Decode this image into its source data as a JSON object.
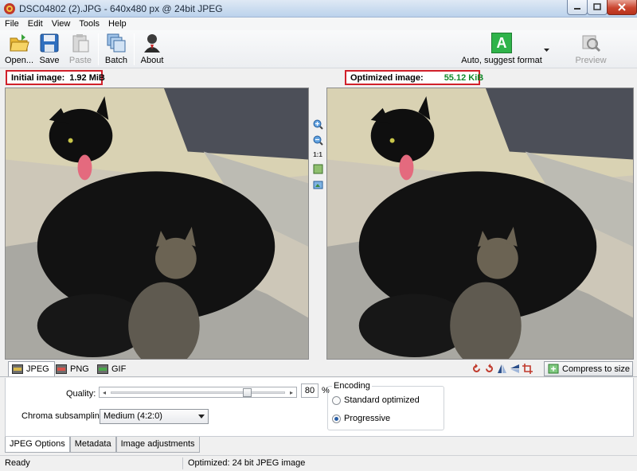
{
  "window": {
    "title": "DSC04802 (2).JPG - 640x480 px @ 24bit JPEG"
  },
  "menu": [
    "File",
    "Edit",
    "View",
    "Tools",
    "Help"
  ],
  "toolbar": {
    "open": "Open...",
    "save": "Save",
    "paste": "Paste",
    "batch": "Batch",
    "about": "About",
    "auto_format": "Auto, suggest format",
    "auto_format_letter": "A",
    "preview": "Preview"
  },
  "info": {
    "initial_label": "Initial image:",
    "initial_value": "1.92 MiB",
    "optimized_label": "Optimized image:",
    "optimized_value": "55.12 KiB"
  },
  "zoom": {
    "one_to_one": "1:1"
  },
  "format_tabs": [
    "JPEG",
    "PNG",
    "GIF"
  ],
  "compress_button": "Compress to size",
  "options": {
    "quality_label": "Quality:",
    "quality_value": "80",
    "quality_fraction": 0.8,
    "percent_sign": "%",
    "chroma_label": "Chroma subsampling:",
    "chroma_value": "Medium (4:2:0)",
    "encoding_title": "Encoding",
    "encoding_options": [
      "Standard optimized",
      "Progressive"
    ],
    "encoding_selected": "Progressive"
  },
  "bottom_tabs": [
    "JPEG Options",
    "Metadata",
    "Image adjustments"
  ],
  "status": {
    "left": "Ready",
    "right": "Optimized: 24 bit JPEG image"
  },
  "colors": {
    "highlight_border": "#d0202a",
    "optimized_value": "#118a2b",
    "auto_format_tile": "#2fb34a"
  }
}
